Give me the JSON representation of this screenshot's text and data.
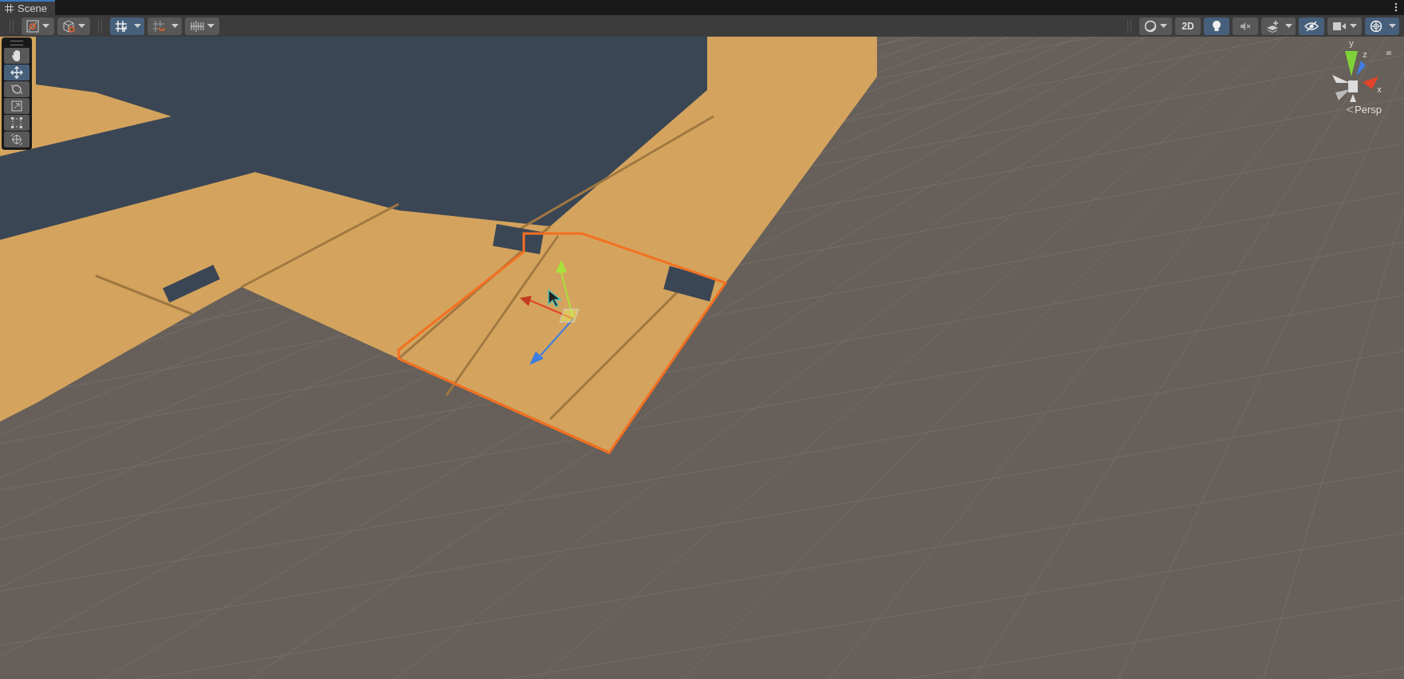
{
  "tab": {
    "label": "Scene",
    "selected": true
  },
  "toolbar_left": [
    {
      "kind": "dropdown",
      "on": false
    },
    {
      "kind": "dropdown",
      "on": false
    },
    {
      "kind": "split",
      "on": true
    },
    {
      "kind": "split",
      "on": false
    },
    {
      "kind": "dropdown",
      "on": false
    }
  ],
  "toolbar_right": [
    {
      "kind": "dropdown",
      "on": false
    },
    {
      "kind": "toggle",
      "label": "2D",
      "on": false
    },
    {
      "kind": "toggle",
      "on": true
    },
    {
      "kind": "toggle",
      "on": false
    },
    {
      "kind": "split",
      "on": false
    },
    {
      "kind": "toggle",
      "on": true
    },
    {
      "kind": "dropdown",
      "on": false
    },
    {
      "kind": "split",
      "on": true
    }
  ],
  "tools": [
    {
      "selected": false
    },
    {
      "selected": true
    },
    {
      "selected": false
    },
    {
      "selected": false
    },
    {
      "selected": false
    },
    {
      "selected": false
    }
  ],
  "orientation_gizmo": {
    "axes": [
      "y",
      "z",
      "x"
    ],
    "projection": "Persp"
  }
}
